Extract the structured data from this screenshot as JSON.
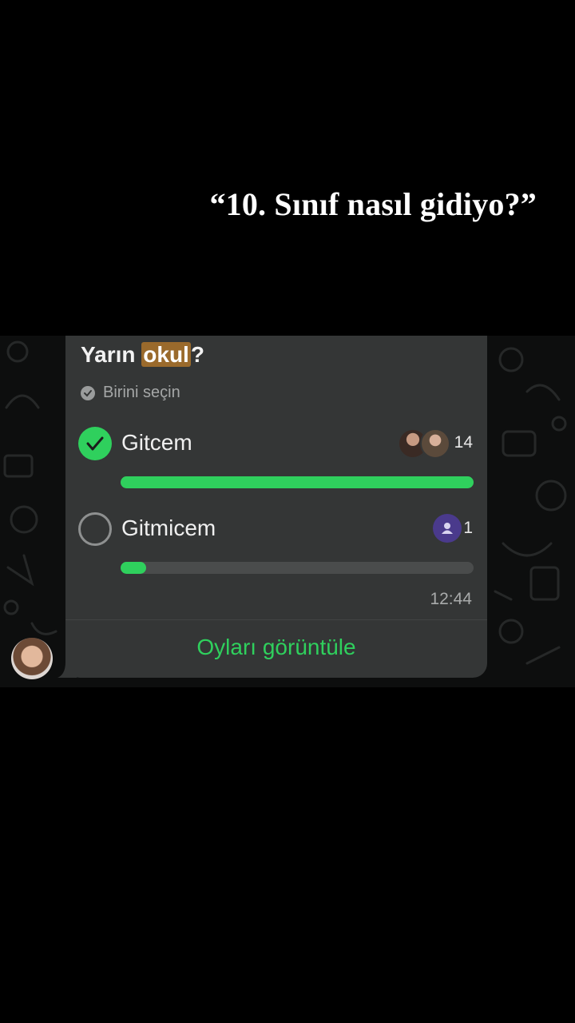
{
  "caption": "“10. Sınıf nasıl gidiyo?”",
  "poll": {
    "question_before": "Yarın ",
    "question_highlight": "okul",
    "question_after": "?",
    "subtitle": "Birini seçin",
    "options": [
      {
        "label": "Gitcem",
        "votes": "14",
        "selected": true,
        "fill_fraction": 1.0
      },
      {
        "label": "Gitmicem",
        "votes": "1",
        "selected": false,
        "fill_fraction": 0.0714
      }
    ],
    "time": "12:44",
    "view_votes": "Oyları görüntüle"
  },
  "colors": {
    "accent_green": "#2fd05d",
    "bubble": "#343636",
    "highlight": "#9a6a2c",
    "anon_avatar": "#4a3a8c"
  },
  "icons": {
    "subtitle": "check-circle-icon",
    "selected": "checkmark-circle-icon",
    "unselected": "empty-circle-icon",
    "anonymous_voter": "person-icon"
  }
}
